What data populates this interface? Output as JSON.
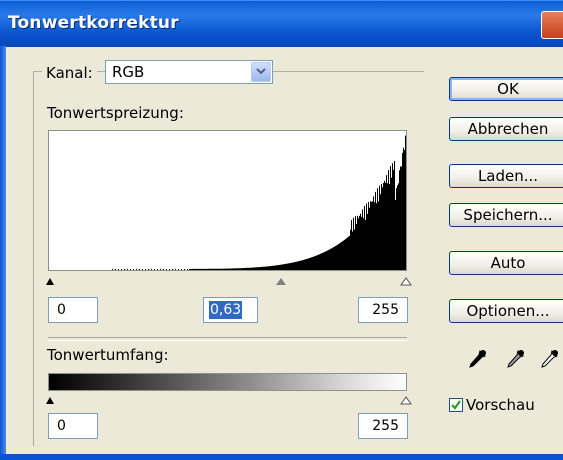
{
  "window": {
    "title": "Tonwertkorrektur"
  },
  "channel": {
    "label": "Kanal:",
    "value": "RGB"
  },
  "input_levels": {
    "label": "Tonwertspreizung:",
    "black_value": "0",
    "gamma_value": "0,63",
    "white_value": "255"
  },
  "output_levels": {
    "label": "Tonwertumfang:",
    "black_value": "0",
    "white_value": "255"
  },
  "buttons": {
    "ok": "OK",
    "cancel": "Abbrechen",
    "load": "Laden...",
    "save": "Speichern...",
    "auto": "Auto",
    "options": "Optionen..."
  },
  "preview": {
    "label": "Vorschau",
    "checked": true
  },
  "icons": {
    "black_eyedropper": "black-eyedropper-icon",
    "gray_eyedropper": "gray-eyedropper-icon",
    "white_eyedropper": "white-eyedropper-icon"
  },
  "colors": {
    "titlebar": "#0a5fd8",
    "dialog_bg": "#ece9d8",
    "selection": "#316ac5"
  }
}
